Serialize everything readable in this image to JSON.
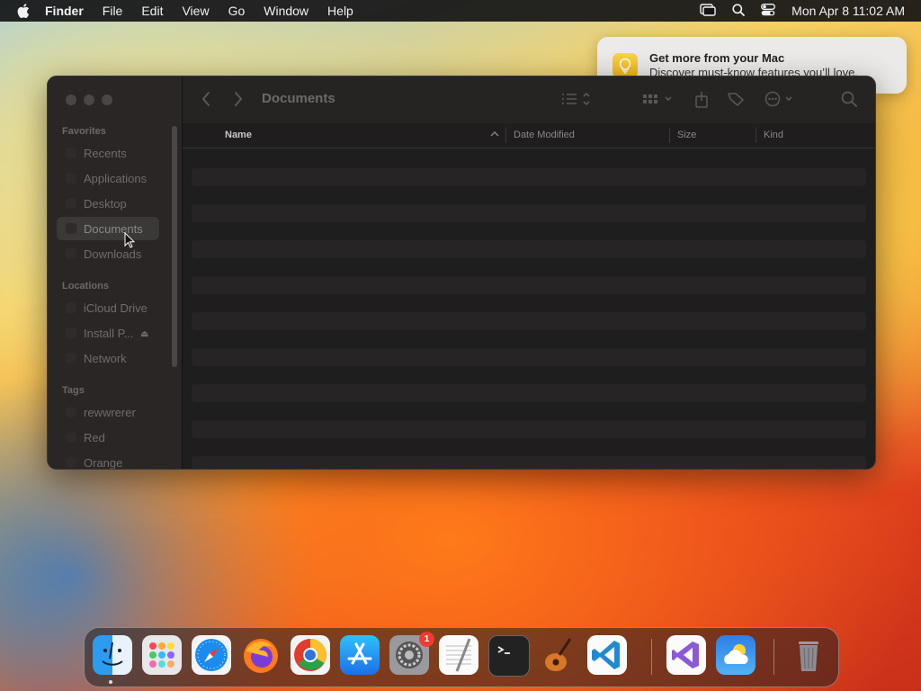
{
  "menubar": {
    "app_name": "Finder",
    "menus": [
      "File",
      "Edit",
      "View",
      "Go",
      "Window",
      "Help"
    ],
    "clock": "Mon Apr 8  11:02 AM",
    "status_icons": [
      "screen-mirroring-icon",
      "spotlight-search-icon",
      "control-center-icon"
    ]
  },
  "notification": {
    "title": "Get more from your Mac",
    "body": "Discover must-know features you’ll love.",
    "icon": "lightbulb-icon"
  },
  "finder": {
    "title": "Documents",
    "sidebar": {
      "favorites_label": "Favorites",
      "favorites": [
        "Recents",
        "Applications",
        "Desktop",
        "Documents",
        "Downloads"
      ],
      "selected": "Documents",
      "locations_label": "Locations",
      "locations": [
        "iCloud Drive",
        "Install P...",
        "Network"
      ],
      "tags_label": "Tags",
      "tags": [
        "rewwrerer",
        "Red",
        "Orange"
      ]
    },
    "columns": {
      "name": "Name",
      "date_modified": "Date Modified",
      "size": "Size",
      "kind": "Kind"
    },
    "sort": "name-ascending"
  },
  "dock": {
    "apps": [
      {
        "name": "Finder",
        "icon": "finder-icon",
        "running": true
      },
      {
        "name": "Launchpad",
        "icon": "launchpad-icon"
      },
      {
        "name": "Safari",
        "icon": "safari-icon"
      },
      {
        "name": "Firefox",
        "icon": "firefox-icon"
      },
      {
        "name": "Chrome",
        "icon": "chrome-icon"
      },
      {
        "name": "App Store",
        "icon": "app-store-icon"
      },
      {
        "name": "System Settings",
        "icon": "system-settings-icon",
        "badge": "1"
      },
      {
        "name": "TextEdit",
        "icon": "textedit-icon"
      },
      {
        "name": "Terminal",
        "icon": "terminal-icon"
      },
      {
        "name": "GarageBand",
        "icon": "garageband-icon"
      },
      {
        "name": "Visual Studio Code",
        "icon": "vscode-icon"
      },
      {
        "name": "Visual Studio",
        "icon": "visual-studio-icon"
      },
      {
        "name": "Weather",
        "icon": "weather-icon"
      },
      {
        "name": "Trash",
        "icon": "trash-icon"
      }
    ]
  }
}
